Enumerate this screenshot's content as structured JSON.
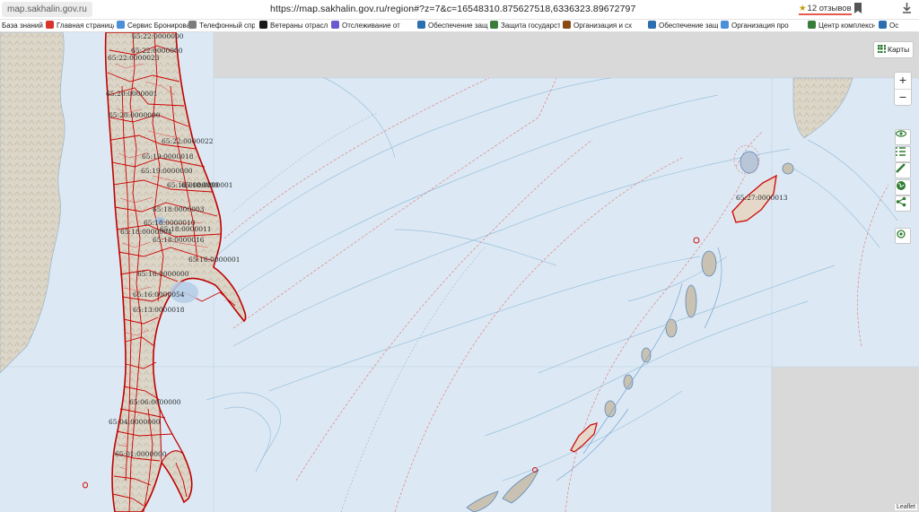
{
  "browser": {
    "site_chip": "map.sakhalin.gov.ru",
    "url": "https://map.sakhalin.gov.ru/region#?z=7&c=16548310.875627518,6336323.89672797",
    "reviews": "12 отзывов",
    "icons": [
      "star-icon",
      "bookmark-icon",
      "download-icon"
    ]
  },
  "bookmarks": [
    {
      "label": "База знаний",
      "color": ""
    },
    {
      "label": "Главная страница",
      "color": "#d9342b"
    },
    {
      "label": "Сервис Бронирова",
      "color": "#4a8fd8"
    },
    {
      "label": "Телефонный спра",
      "color": "#7d7d7d"
    },
    {
      "label": "Ветераны отрасл",
      "color": "#1a1a1a"
    },
    {
      "label": "Отслеживание от",
      "color": "#6a5acd"
    },
    {
      "label": "Обеспечение защ",
      "color": "#2b6fb0"
    },
    {
      "label": "Защита государст",
      "color": "#3a7d3a"
    },
    {
      "label": "Организация и сх",
      "color": "#8a4a12"
    },
    {
      "label": "Обеспечение защ",
      "color": "#2b6fb0"
    },
    {
      "label": "Организация про",
      "color": "#4a8fd8"
    },
    {
      "label": "Центр комплексн",
      "color": "#3a7d3a"
    },
    {
      "label": "Ос",
      "color": "#2b6fb0"
    }
  ],
  "map": {
    "layers_button": "Карты",
    "zoom_in": "+",
    "zoom_out": "−",
    "attribution": "Leaflet",
    "tools": [
      {
        "name": "eye-icon",
        "glyph": "👁"
      },
      {
        "name": "legend-list-icon",
        "glyph": "☰"
      },
      {
        "name": "ruler-icon",
        "glyph": "✎"
      },
      {
        "name": "globe-icon",
        "glyph": "◍"
      },
      {
        "name": "share-icon",
        "glyph": "⋖"
      },
      {
        "name": "locate-icon",
        "glyph": "◎"
      }
    ],
    "parcel_labels": [
      "65:22:0000000",
      "65:22:0000023",
      "65:22:0000000",
      "65:20:0000001",
      "65:20:0000000",
      "65:22:0000022",
      "65:19:0000018",
      "65:19:0000000",
      "65:18:0000000",
      "65:18:0000001",
      "65:18:0000003",
      "65:18:0000010",
      "65:18:0000004",
      "65:18:0000011",
      "65:18:0000016",
      "65:16:0000001",
      "65:16:0000000",
      "65:16:0000054",
      "65:13:0000018",
      "65:06:0000000",
      "65:04:0000000",
      "65:01:0000000",
      "65:27:0000013"
    ]
  }
}
